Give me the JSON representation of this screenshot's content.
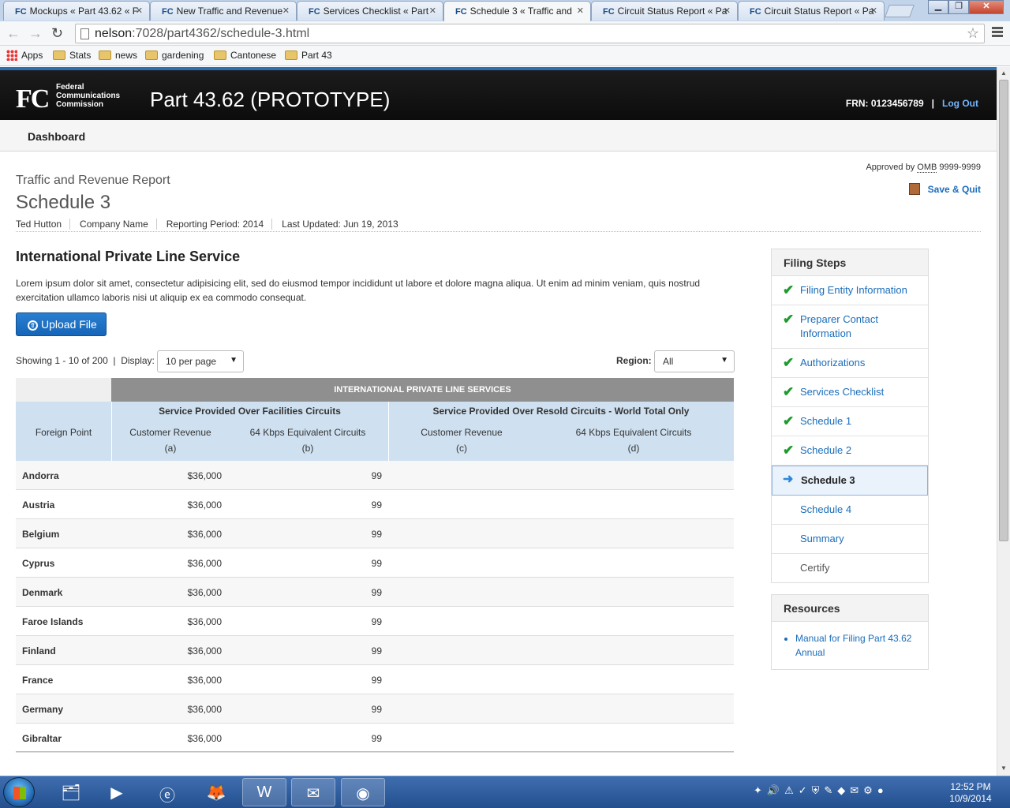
{
  "browser": {
    "tabs": [
      {
        "favicon": "FC",
        "title": "Mockups « Part 43.62 « F"
      },
      {
        "favicon": "FC",
        "title": "New Traffic and Revenue"
      },
      {
        "favicon": "FC",
        "title": "Services Checklist « Part"
      },
      {
        "favicon": "FC",
        "title": "Schedule 3 « Traffic and"
      },
      {
        "favicon": "FC",
        "title": "Circuit Status Report « Pa"
      },
      {
        "favicon": "FC",
        "title": "Circuit Status Report « Pa"
      }
    ],
    "url_host": "nelson",
    "url_path": ":7028/part4362/schedule-3.html",
    "bookmarks": [
      "Apps",
      "Stats",
      "news",
      "gardening",
      "Cantonese",
      "Part 43"
    ]
  },
  "header": {
    "logo": "FC",
    "agency_line1": "Federal",
    "agency_line2": "Communications",
    "agency_line3": "Commission",
    "app_title": "Part 43.62 (PROTOTYPE)",
    "frn": "FRN: 0123456789",
    "separator": "|",
    "logout": "Log Out"
  },
  "nav": {
    "dashboard": "Dashboard"
  },
  "page": {
    "approved_prefix": "Approved by",
    "approved_omb": "OMB",
    "approved_number": "9999-9999",
    "save_quit": "Save & Quit",
    "subtitle": "Traffic and Revenue Report",
    "title": "Schedule 3",
    "meta": {
      "user": "Ted Hutton",
      "company": "Company Name",
      "period": "Reporting Period: 2014",
      "updated": "Last Updated: Jun 19, 2013"
    },
    "section_title": "International Private Line Service",
    "description": "Lorem ipsum dolor sit amet, consectetur adipisicing elit, sed do eiusmod tempor incididunt ut labore et dolore magna aliqua. Ut enim ad minim veniam, quis nostrud exercitation ullamco laboris nisi ut aliquip ex ea commodo consequat.",
    "upload_label": "Upload File",
    "showing": "Showing 1 - 10 of 200",
    "display_label": "Display:",
    "display_value": "10 per page",
    "region_label": "Region:",
    "region_value": "All"
  },
  "table": {
    "banner": "INTERNATIONAL PRIVATE LINE SERVICES",
    "group_facilities": "Service Provided Over Facilities Circuits",
    "group_resold": "Service Provided Over Resold Circuits - World Total Only",
    "col_foreign": "Foreign Point",
    "col_a": "Customer Revenue",
    "col_a_code": "(a)",
    "col_b": "64 Kbps Equivalent Circuits",
    "col_b_code": "(b)",
    "col_c": "Customer Revenue",
    "col_c_code": "(c)",
    "col_d": "64 Kbps Equivalent Circuits",
    "col_d_code": "(d)",
    "rows": [
      {
        "point": "Andorra",
        "revenue": "$36,000",
        "circuits": "99"
      },
      {
        "point": "Austria",
        "revenue": "$36,000",
        "circuits": "99"
      },
      {
        "point": "Belgium",
        "revenue": "$36,000",
        "circuits": "99"
      },
      {
        "point": "Cyprus",
        "revenue": "$36,000",
        "circuits": "99"
      },
      {
        "point": "Denmark",
        "revenue": "$36,000",
        "circuits": "99"
      },
      {
        "point": "Faroe Islands",
        "revenue": "$36,000",
        "circuits": "99"
      },
      {
        "point": "Finland",
        "revenue": "$36,000",
        "circuits": "99"
      },
      {
        "point": "France",
        "revenue": "$36,000",
        "circuits": "99"
      },
      {
        "point": "Germany",
        "revenue": "$36,000",
        "circuits": "99"
      },
      {
        "point": "Gibraltar",
        "revenue": "$36,000",
        "circuits": "99"
      }
    ]
  },
  "sidebar": {
    "filing_title": "Filing Steps",
    "steps": [
      {
        "label": "Filing Entity Information",
        "state": "done"
      },
      {
        "label": "Preparer Contact Information",
        "state": "done"
      },
      {
        "label": "Authorizations",
        "state": "done"
      },
      {
        "label": "Services Checklist",
        "state": "done"
      },
      {
        "label": "Schedule 1",
        "state": "done"
      },
      {
        "label": "Schedule 2",
        "state": "done"
      },
      {
        "label": "Schedule 3",
        "state": "current"
      },
      {
        "label": "Schedule 4",
        "state": "todo"
      },
      {
        "label": "Summary",
        "state": "todo"
      },
      {
        "label": "Certify",
        "state": "disabled"
      }
    ],
    "resources_title": "Resources",
    "resources": [
      "Manual for Filing Part 43.62 Annual"
    ]
  },
  "taskbar": {
    "time": "12:52 PM",
    "date": "10/9/2014"
  }
}
